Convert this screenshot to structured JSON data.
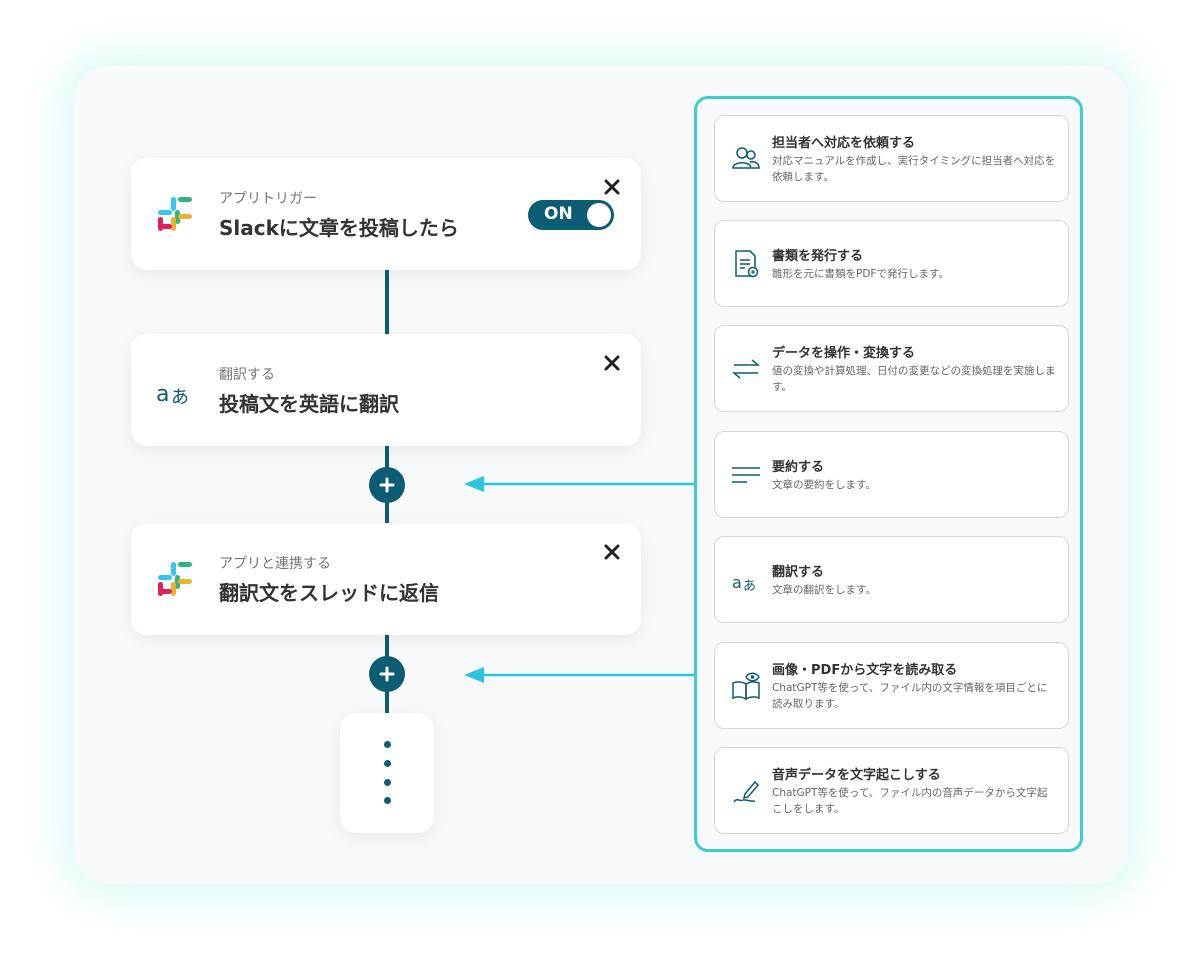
{
  "flow": {
    "nodes": [
      {
        "sub": "アプリトリガー",
        "title": "Slackに文章を投稿したら",
        "icon": "slack-logo-icon"
      },
      {
        "sub": "翻訳する",
        "title": "投稿文を英語に翻訳",
        "icon": "translate-icon"
      },
      {
        "sub": "アプリと連携する",
        "title": "翻訳文をスレッドに返信",
        "icon": "slack-logo-icon"
      }
    ],
    "toggle_label": "ON"
  },
  "actions": [
    {
      "title": "担当者へ対応を依頼する",
      "desc": "対応マニュアルを作成し、実行タイミングに担当者へ対応を依頼します。",
      "icon": "people-icon"
    },
    {
      "title": "書類を発行する",
      "desc": "雛形を元に書類をPDFで発行します。",
      "icon": "document-icon"
    },
    {
      "title": "データを操作・変換する",
      "desc": "値の変換や計算処理、日付の変更などの変換処理を実施します。",
      "icon": "swap-arrows-icon"
    },
    {
      "title": "要約する",
      "desc": "文章の要約をします。",
      "icon": "summary-lines-icon"
    },
    {
      "title": "翻訳する",
      "desc": "文章の翻訳をします。",
      "icon": "translate-icon"
    },
    {
      "title": "画像・PDFから文字を読み取る",
      "desc": "ChatGPT等を使って、ファイル内の文字情報を項目ごとに読み取ります。",
      "icon": "book-eye-icon"
    },
    {
      "title": "音声データを文字起こしする",
      "desc": "ChatGPT等を使って、ファイル内の音声データから文字起こしをします。",
      "icon": "pen-icon"
    }
  ],
  "colors": {
    "primary": "#0c5d73",
    "accent": "#3ccdcd",
    "arrow": "#2ec4e0"
  }
}
